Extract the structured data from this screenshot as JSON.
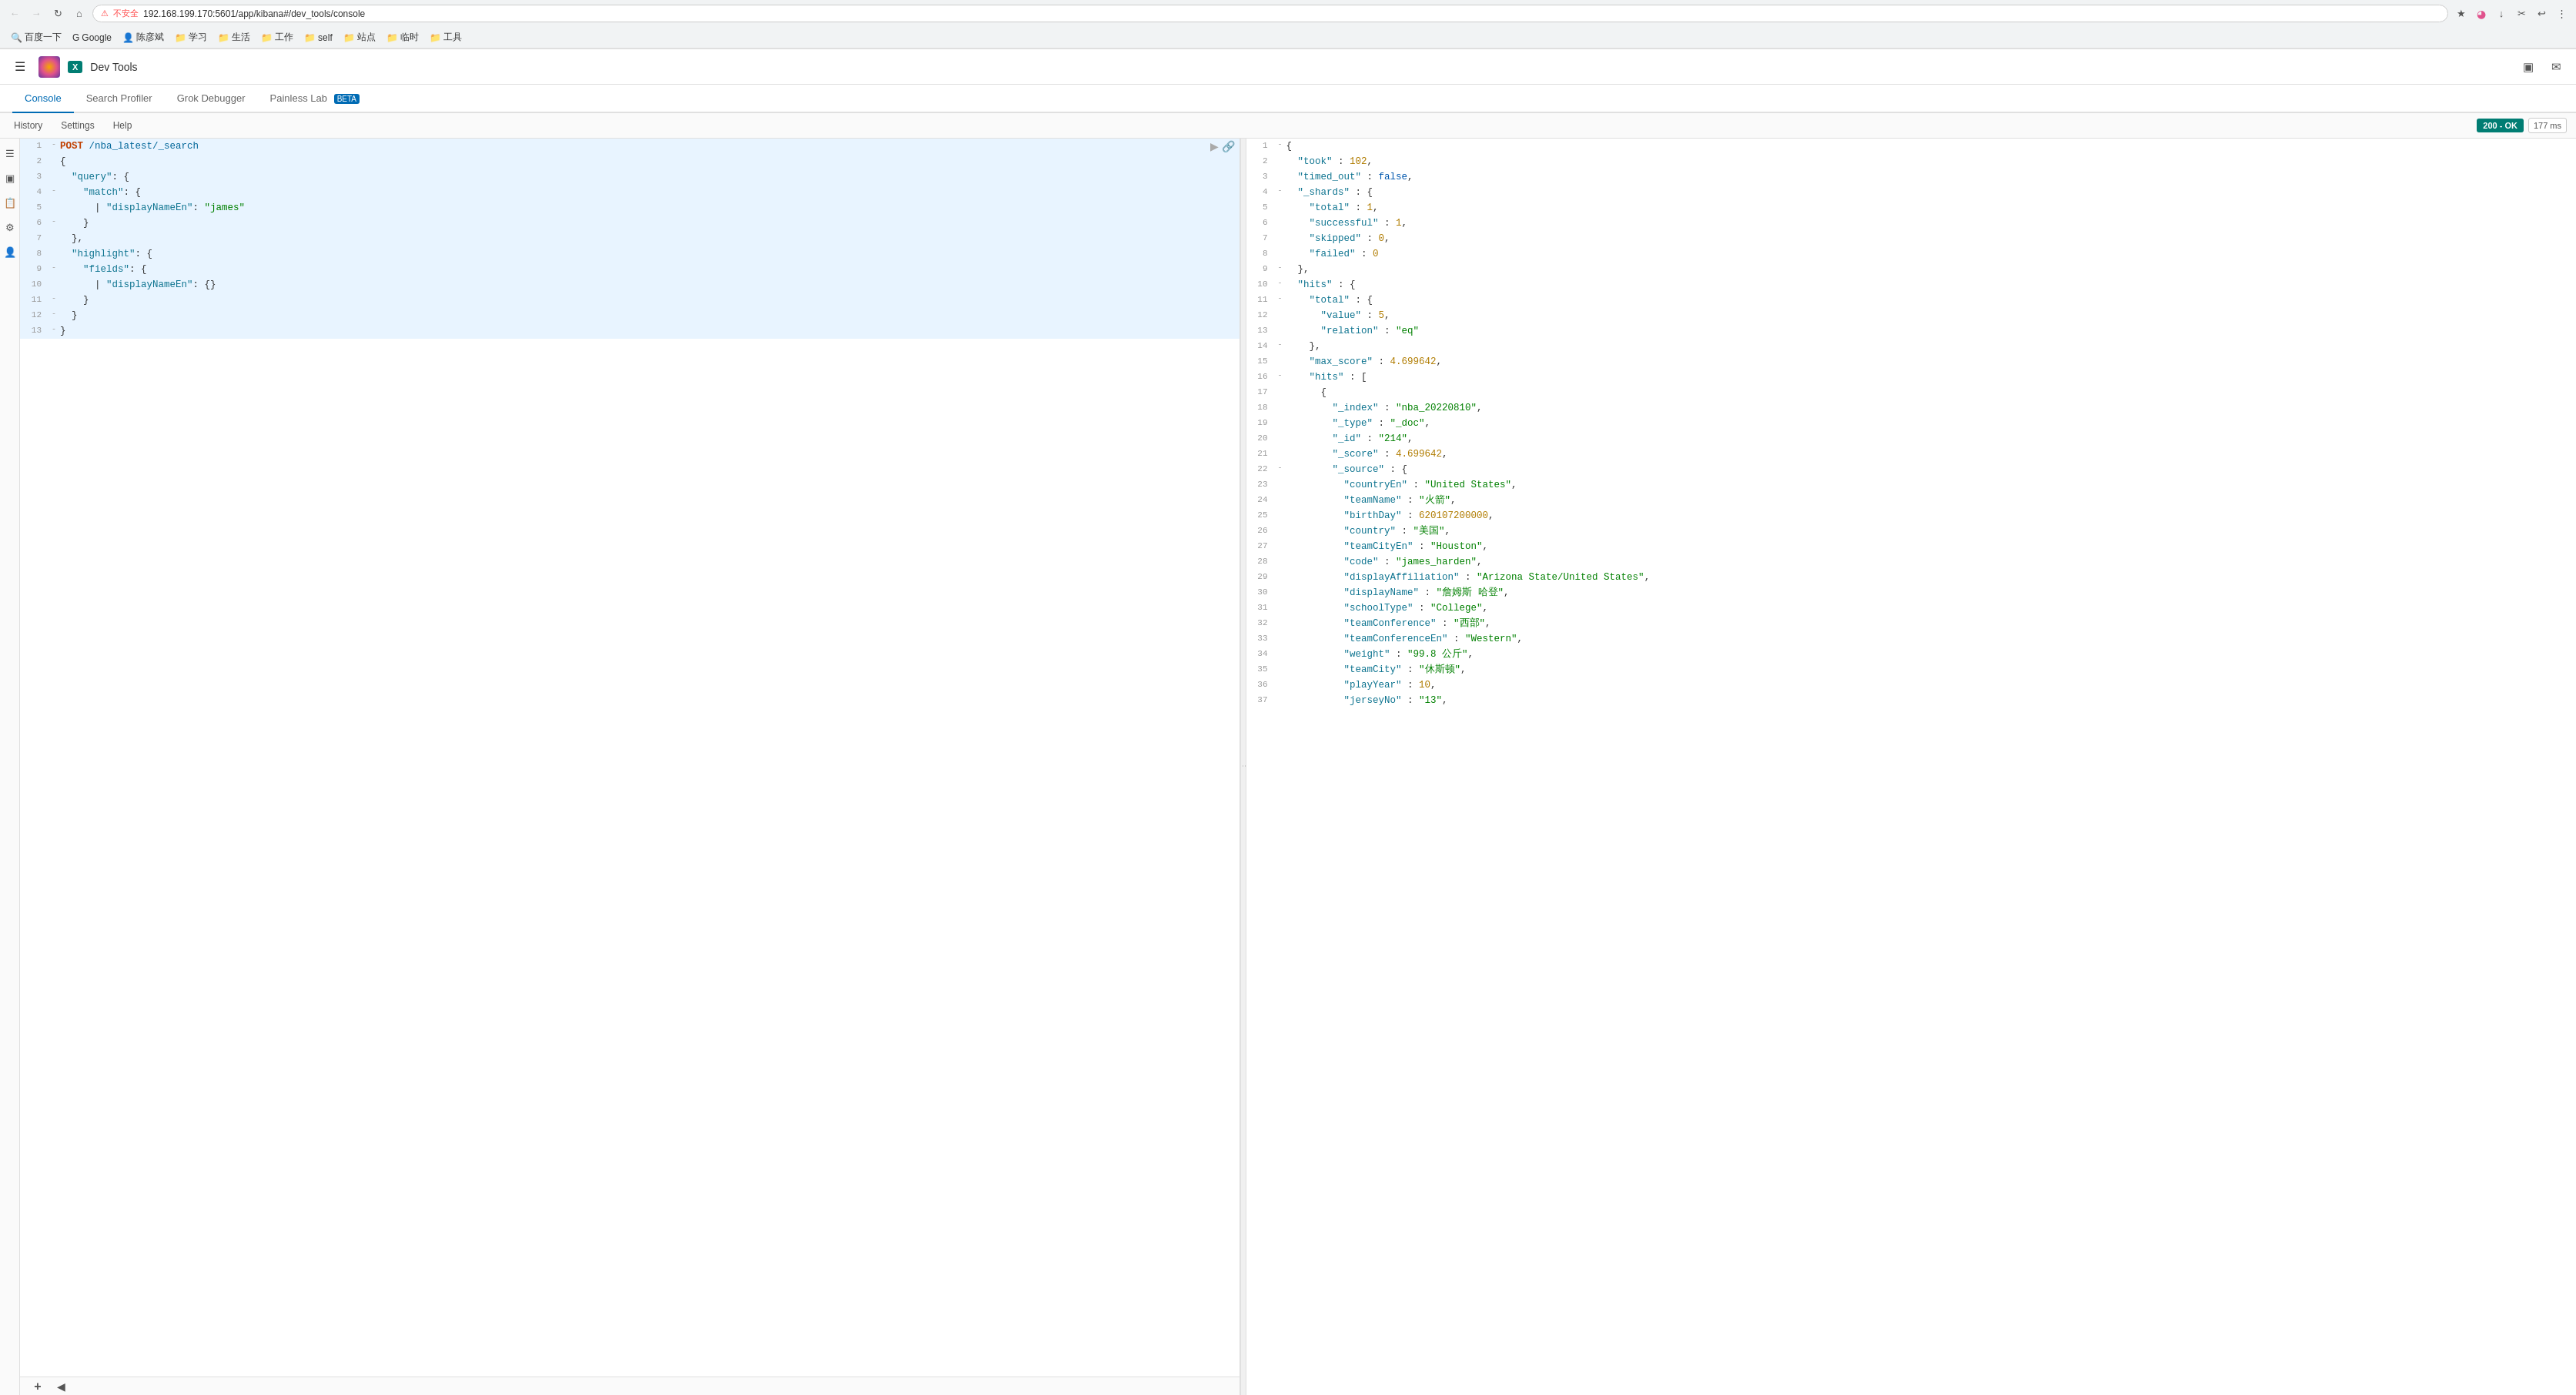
{
  "browser": {
    "back_btn": "←",
    "forward_btn": "→",
    "reload_btn": "↻",
    "home_btn": "⌂",
    "lock_text": "不安全",
    "url": "192.168.199.170:5601/app/kibana#/dev_tools/console",
    "secure_icon": "🔒",
    "warning_icon": "⚠"
  },
  "bookmarks": [
    {
      "label": "百度一下",
      "icon": "🔍"
    },
    {
      "label": "Google",
      "icon": "G"
    },
    {
      "label": "陈彦斌",
      "icon": "👤"
    },
    {
      "label": "学习",
      "icon": "📁"
    },
    {
      "label": "生活",
      "icon": "📁"
    },
    {
      "label": "工作",
      "icon": "📁"
    },
    {
      "label": "self",
      "icon": "📁"
    },
    {
      "label": "站点",
      "icon": "📁"
    },
    {
      "label": "临时",
      "icon": "📁"
    },
    {
      "label": "工具",
      "icon": "📁"
    }
  ],
  "app": {
    "title": "Dev Tools",
    "badge_text": "X"
  },
  "tabs": [
    {
      "label": "Console",
      "active": true
    },
    {
      "label": "Search Profiler",
      "active": false
    },
    {
      "label": "Grok Debugger",
      "active": false
    },
    {
      "label": "Painless Lab",
      "active": false,
      "beta": true
    }
  ],
  "toolbar": {
    "history_label": "History",
    "settings_label": "Settings",
    "help_label": "Help",
    "status_label": "200 - OK",
    "time_label": "177 ms"
  },
  "editor": {
    "lines": [
      {
        "num": 1,
        "fold": "-",
        "content": "POST /nba_latest/_search",
        "type": "request"
      },
      {
        "num": 2,
        "fold": "",
        "content": "{",
        "type": "punc"
      },
      {
        "num": 3,
        "fold": "",
        "content": "  \"query\": {",
        "type": "obj"
      },
      {
        "num": 4,
        "fold": "-",
        "content": "    \"match\": {",
        "type": "obj"
      },
      {
        "num": 5,
        "fold": "",
        "content": "      | \"displayNameEn\": \"james\"",
        "type": "str"
      },
      {
        "num": 6,
        "fold": "-",
        "content": "    }",
        "type": "punc"
      },
      {
        "num": 7,
        "fold": "",
        "content": "  },",
        "type": "punc"
      },
      {
        "num": 8,
        "fold": "",
        "content": "  \"highlight\": {",
        "type": "obj"
      },
      {
        "num": 9,
        "fold": "-",
        "content": "    \"fields\": {",
        "type": "obj"
      },
      {
        "num": 10,
        "fold": "",
        "content": "      | \"displayNameEn\": {}",
        "type": "str"
      },
      {
        "num": 11,
        "fold": "-",
        "content": "    }",
        "type": "punc"
      },
      {
        "num": 12,
        "fold": "-",
        "content": "  }",
        "type": "punc"
      },
      {
        "num": 13,
        "fold": "-",
        "content": "}",
        "type": "punc"
      }
    ]
  },
  "response": {
    "lines": [
      {
        "num": 1,
        "fold": "-",
        "content": "{"
      },
      {
        "num": 2,
        "fold": "",
        "content": "  \"took\" : 102,"
      },
      {
        "num": 3,
        "fold": "",
        "content": "  \"timed_out\" : false,"
      },
      {
        "num": 4,
        "fold": "-",
        "content": "  \"_shards\" : {"
      },
      {
        "num": 5,
        "fold": "",
        "content": "    \"total\" : 1,"
      },
      {
        "num": 6,
        "fold": "",
        "content": "    \"successful\" : 1,"
      },
      {
        "num": 7,
        "fold": "",
        "content": "    \"skipped\" : 0,"
      },
      {
        "num": 8,
        "fold": "",
        "content": "    \"failed\" : 0"
      },
      {
        "num": 9,
        "fold": "-",
        "content": "  },"
      },
      {
        "num": 10,
        "fold": "-",
        "content": "  \"hits\" : {"
      },
      {
        "num": 11,
        "fold": "-",
        "content": "    \"total\" : {"
      },
      {
        "num": 12,
        "fold": "",
        "content": "      \"value\" : 5,"
      },
      {
        "num": 13,
        "fold": "",
        "content": "      \"relation\" : \"eq\""
      },
      {
        "num": 14,
        "fold": "-",
        "content": "    },"
      },
      {
        "num": 15,
        "fold": "",
        "content": "    \"max_score\" : 4.699642,"
      },
      {
        "num": 16,
        "fold": "-",
        "content": "    \"hits\" : ["
      },
      {
        "num": 17,
        "fold": "",
        "content": "      {"
      },
      {
        "num": 18,
        "fold": "",
        "content": "        \"_index\" : \"nba_20220810\","
      },
      {
        "num": 19,
        "fold": "",
        "content": "        \"_type\" : \"_doc\","
      },
      {
        "num": 20,
        "fold": "",
        "content": "        \"_id\" : \"214\","
      },
      {
        "num": 21,
        "fold": "",
        "content": "        \"_score\" : 4.699642,"
      },
      {
        "num": 22,
        "fold": "-",
        "content": "        \"_source\" : {"
      },
      {
        "num": 23,
        "fold": "",
        "content": "          \"countryEn\" : \"United States\","
      },
      {
        "num": 24,
        "fold": "",
        "content": "          \"teamName\" : \"火箭\","
      },
      {
        "num": 25,
        "fold": "",
        "content": "          \"birthDay\" : 620107200000,"
      },
      {
        "num": 26,
        "fold": "",
        "content": "          \"country\" : \"美国\","
      },
      {
        "num": 27,
        "fold": "",
        "content": "          \"teamCityEn\" : \"Houston\","
      },
      {
        "num": 28,
        "fold": "",
        "content": "          \"code\" : \"james_harden\","
      },
      {
        "num": 29,
        "fold": "",
        "content": "          \"displayAffiliation\" : \"Arizona State/United States\","
      },
      {
        "num": 30,
        "fold": "",
        "content": "          \"displayName\" : \"詹姆斯 哈登\","
      },
      {
        "num": 31,
        "fold": "",
        "content": "          \"schoolType\" : \"College\","
      },
      {
        "num": 32,
        "fold": "",
        "content": "          \"teamConference\" : \"西部\","
      },
      {
        "num": 33,
        "fold": "",
        "content": "          \"teamConferenceEn\" : \"Western\","
      },
      {
        "num": 34,
        "fold": "",
        "content": "          \"weight\" : \"99.8 公斤\","
      },
      {
        "num": 35,
        "fold": "",
        "content": "          \"teamCity\" : \"休斯顿\","
      },
      {
        "num": 36,
        "fold": "",
        "content": "          \"playYear\" : 10,"
      },
      {
        "num": 37,
        "fold": "",
        "content": "          \"jerseyNo\" : \"13\","
      }
    ]
  }
}
